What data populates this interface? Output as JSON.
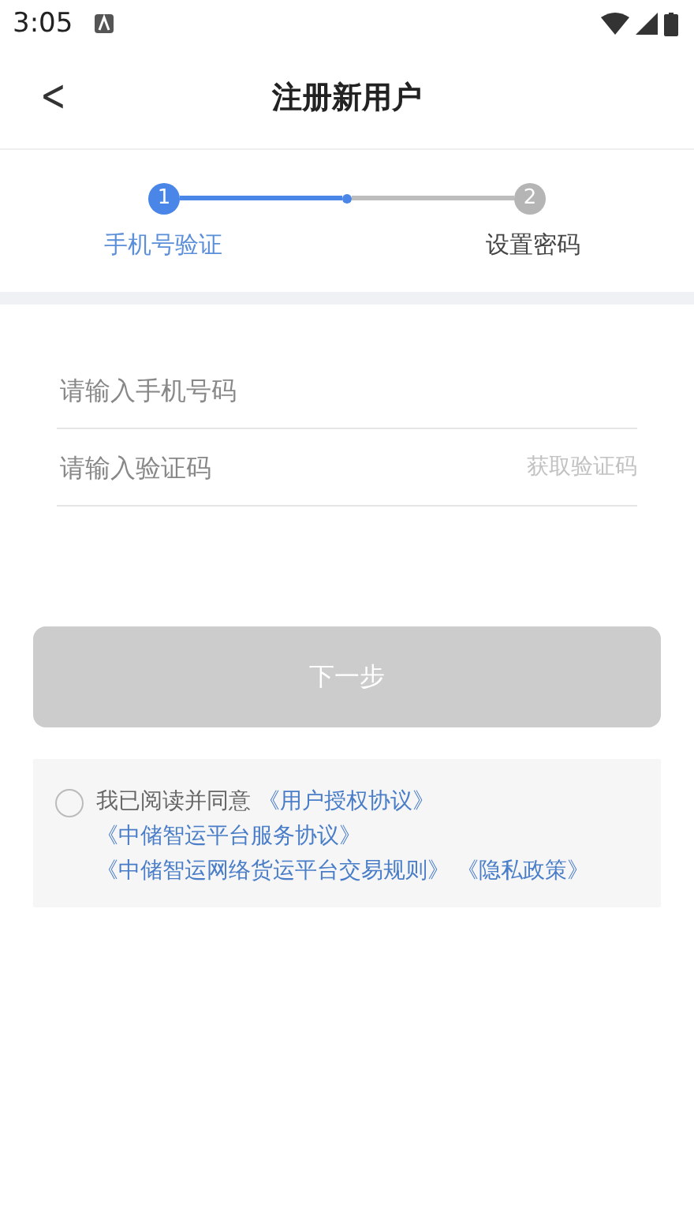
{
  "status_bar": {
    "time": "3:05"
  },
  "header": {
    "back": "<",
    "title": "注册新用户"
  },
  "steps": [
    {
      "number": "1",
      "label": "手机号验证",
      "selected": true
    },
    {
      "number": "2",
      "label": "设置密码",
      "selected": false
    }
  ],
  "form": {
    "phone": {
      "placeholder": "请输入手机号码"
    },
    "code": {
      "placeholder": "请输入验证码",
      "action": "获取验证码"
    }
  },
  "next_button": {
    "label": "下一步",
    "disabled": true
  },
  "agreement": {
    "checked": false,
    "text": "我已阅读并同意",
    "links": [
      "《用户授权协议》",
      "《中储智运平台服务协议》",
      "《中储智运网络货运平台交易规则》",
      "《隐私政策》"
    ]
  }
}
